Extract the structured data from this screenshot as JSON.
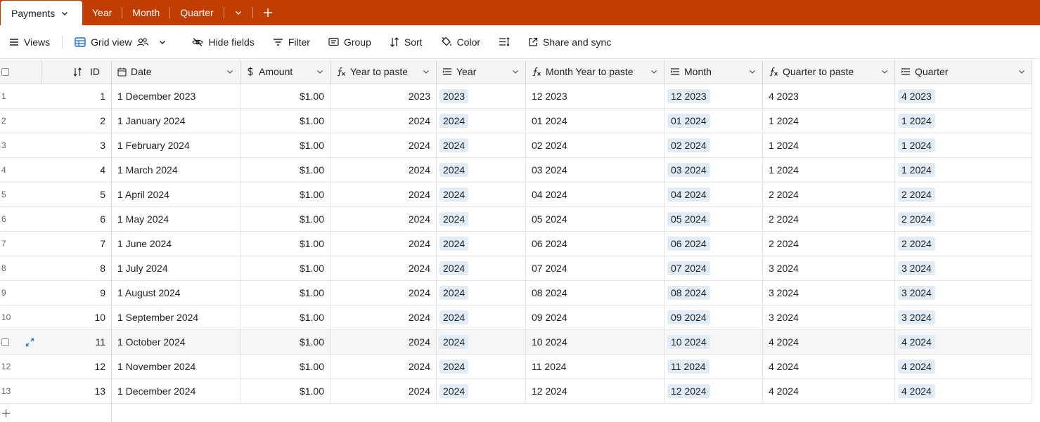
{
  "tabs": {
    "active": "Payments",
    "items": [
      "Year",
      "Month",
      "Quarter"
    ]
  },
  "toolbar": {
    "views": "Views",
    "grid_view": "Grid view",
    "hide_fields": "Hide fields",
    "filter": "Filter",
    "group": "Group",
    "sort": "Sort",
    "color": "Color",
    "share": "Share and sync"
  },
  "columns": {
    "id": "ID",
    "date": "Date",
    "amount": "Amount",
    "year_to_paste": "Year to paste",
    "year": "Year",
    "month_year_to_paste": "Month Year to paste",
    "month": "Month",
    "quarter_to_paste": "Quarter to paste",
    "quarter": "Quarter"
  },
  "rows": [
    {
      "num": "1",
      "id": "1",
      "date": "1 December 2023",
      "amount": "$1.00",
      "ytp": "2023",
      "year": "2023",
      "mytp": "12 2023",
      "month": "12 2023",
      "qtp": "4 2023",
      "quarter": "4 2023"
    },
    {
      "num": "2",
      "id": "2",
      "date": "1 January 2024",
      "amount": "$1.00",
      "ytp": "2024",
      "year": "2024",
      "mytp": "01 2024",
      "month": "01 2024",
      "qtp": "1 2024",
      "quarter": "1 2024"
    },
    {
      "num": "3",
      "id": "3",
      "date": "1 February 2024",
      "amount": "$1.00",
      "ytp": "2024",
      "year": "2024",
      "mytp": "02 2024",
      "month": "02 2024",
      "qtp": "1 2024",
      "quarter": "1 2024"
    },
    {
      "num": "4",
      "id": "4",
      "date": "1 March 2024",
      "amount": "$1.00",
      "ytp": "2024",
      "year": "2024",
      "mytp": "03 2024",
      "month": "03 2024",
      "qtp": "1 2024",
      "quarter": "1 2024"
    },
    {
      "num": "5",
      "id": "5",
      "date": "1 April 2024",
      "amount": "$1.00",
      "ytp": "2024",
      "year": "2024",
      "mytp": "04 2024",
      "month": "04 2024",
      "qtp": "2 2024",
      "quarter": "2 2024"
    },
    {
      "num": "6",
      "id": "6",
      "date": "1 May 2024",
      "amount": "$1.00",
      "ytp": "2024",
      "year": "2024",
      "mytp": "05 2024",
      "month": "05 2024",
      "qtp": "2 2024",
      "quarter": "2 2024"
    },
    {
      "num": "7",
      "id": "7",
      "date": "1 June 2024",
      "amount": "$1.00",
      "ytp": "2024",
      "year": "2024",
      "mytp": "06 2024",
      "month": "06 2024",
      "qtp": "2 2024",
      "quarter": "2 2024"
    },
    {
      "num": "8",
      "id": "8",
      "date": "1 July 2024",
      "amount": "$1.00",
      "ytp": "2024",
      "year": "2024",
      "mytp": "07 2024",
      "month": "07 2024",
      "qtp": "3 2024",
      "quarter": "3 2024"
    },
    {
      "num": "9",
      "id": "9",
      "date": "1 August 2024",
      "amount": "$1.00",
      "ytp": "2024",
      "year": "2024",
      "mytp": "08 2024",
      "month": "08 2024",
      "qtp": "3 2024",
      "quarter": "3 2024"
    },
    {
      "num": "10",
      "id": "10",
      "date": "1 September 2024",
      "amount": "$1.00",
      "ytp": "2024",
      "year": "2024",
      "mytp": "09 2024",
      "month": "09 2024",
      "qtp": "3 2024",
      "quarter": "3 2024"
    },
    {
      "num": "",
      "id": "11",
      "date": "1 October 2024",
      "amount": "$1.00",
      "ytp": "2024",
      "year": "2024",
      "mytp": "10 2024",
      "month": "10 2024",
      "qtp": "4 2024",
      "quarter": "4 2024",
      "hover": true
    },
    {
      "num": "12",
      "id": "12",
      "date": "1 November 2024",
      "amount": "$1.00",
      "ytp": "2024",
      "year": "2024",
      "mytp": "11 2024",
      "month": "11 2024",
      "qtp": "4 2024",
      "quarter": "4 2024"
    },
    {
      "num": "13",
      "id": "13",
      "date": "1 December 2024",
      "amount": "$1.00",
      "ytp": "2024",
      "year": "2024",
      "mytp": "12 2024",
      "month": "12 2024",
      "qtp": "4 2024",
      "quarter": "4 2024"
    }
  ],
  "colors": {
    "tabbar": "#c13e02",
    "pill": "#e2ebf8",
    "view_icon": "#1f6ad6"
  }
}
